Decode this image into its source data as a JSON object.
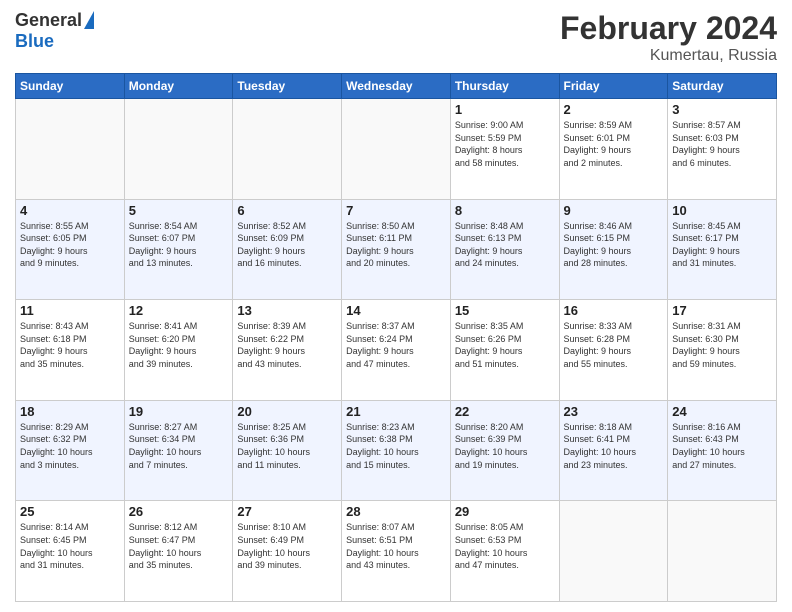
{
  "header": {
    "logo_general": "General",
    "logo_blue": "Blue",
    "title": "February 2024",
    "subtitle": "Kumertau, Russia"
  },
  "weekdays": [
    "Sunday",
    "Monday",
    "Tuesday",
    "Wednesday",
    "Thursday",
    "Friday",
    "Saturday"
  ],
  "weeks": [
    [
      {
        "day": "",
        "info": ""
      },
      {
        "day": "",
        "info": ""
      },
      {
        "day": "",
        "info": ""
      },
      {
        "day": "",
        "info": ""
      },
      {
        "day": "1",
        "info": "Sunrise: 9:00 AM\nSunset: 5:59 PM\nDaylight: 8 hours\nand 58 minutes."
      },
      {
        "day": "2",
        "info": "Sunrise: 8:59 AM\nSunset: 6:01 PM\nDaylight: 9 hours\nand 2 minutes."
      },
      {
        "day": "3",
        "info": "Sunrise: 8:57 AM\nSunset: 6:03 PM\nDaylight: 9 hours\nand 6 minutes."
      }
    ],
    [
      {
        "day": "4",
        "info": "Sunrise: 8:55 AM\nSunset: 6:05 PM\nDaylight: 9 hours\nand 9 minutes."
      },
      {
        "day": "5",
        "info": "Sunrise: 8:54 AM\nSunset: 6:07 PM\nDaylight: 9 hours\nand 13 minutes."
      },
      {
        "day": "6",
        "info": "Sunrise: 8:52 AM\nSunset: 6:09 PM\nDaylight: 9 hours\nand 16 minutes."
      },
      {
        "day": "7",
        "info": "Sunrise: 8:50 AM\nSunset: 6:11 PM\nDaylight: 9 hours\nand 20 minutes."
      },
      {
        "day": "8",
        "info": "Sunrise: 8:48 AM\nSunset: 6:13 PM\nDaylight: 9 hours\nand 24 minutes."
      },
      {
        "day": "9",
        "info": "Sunrise: 8:46 AM\nSunset: 6:15 PM\nDaylight: 9 hours\nand 28 minutes."
      },
      {
        "day": "10",
        "info": "Sunrise: 8:45 AM\nSunset: 6:17 PM\nDaylight: 9 hours\nand 31 minutes."
      }
    ],
    [
      {
        "day": "11",
        "info": "Sunrise: 8:43 AM\nSunset: 6:18 PM\nDaylight: 9 hours\nand 35 minutes."
      },
      {
        "day": "12",
        "info": "Sunrise: 8:41 AM\nSunset: 6:20 PM\nDaylight: 9 hours\nand 39 minutes."
      },
      {
        "day": "13",
        "info": "Sunrise: 8:39 AM\nSunset: 6:22 PM\nDaylight: 9 hours\nand 43 minutes."
      },
      {
        "day": "14",
        "info": "Sunrise: 8:37 AM\nSunset: 6:24 PM\nDaylight: 9 hours\nand 47 minutes."
      },
      {
        "day": "15",
        "info": "Sunrise: 8:35 AM\nSunset: 6:26 PM\nDaylight: 9 hours\nand 51 minutes."
      },
      {
        "day": "16",
        "info": "Sunrise: 8:33 AM\nSunset: 6:28 PM\nDaylight: 9 hours\nand 55 minutes."
      },
      {
        "day": "17",
        "info": "Sunrise: 8:31 AM\nSunset: 6:30 PM\nDaylight: 9 hours\nand 59 minutes."
      }
    ],
    [
      {
        "day": "18",
        "info": "Sunrise: 8:29 AM\nSunset: 6:32 PM\nDaylight: 10 hours\nand 3 minutes."
      },
      {
        "day": "19",
        "info": "Sunrise: 8:27 AM\nSunset: 6:34 PM\nDaylight: 10 hours\nand 7 minutes."
      },
      {
        "day": "20",
        "info": "Sunrise: 8:25 AM\nSunset: 6:36 PM\nDaylight: 10 hours\nand 11 minutes."
      },
      {
        "day": "21",
        "info": "Sunrise: 8:23 AM\nSunset: 6:38 PM\nDaylight: 10 hours\nand 15 minutes."
      },
      {
        "day": "22",
        "info": "Sunrise: 8:20 AM\nSunset: 6:39 PM\nDaylight: 10 hours\nand 19 minutes."
      },
      {
        "day": "23",
        "info": "Sunrise: 8:18 AM\nSunset: 6:41 PM\nDaylight: 10 hours\nand 23 minutes."
      },
      {
        "day": "24",
        "info": "Sunrise: 8:16 AM\nSunset: 6:43 PM\nDaylight: 10 hours\nand 27 minutes."
      }
    ],
    [
      {
        "day": "25",
        "info": "Sunrise: 8:14 AM\nSunset: 6:45 PM\nDaylight: 10 hours\nand 31 minutes."
      },
      {
        "day": "26",
        "info": "Sunrise: 8:12 AM\nSunset: 6:47 PM\nDaylight: 10 hours\nand 35 minutes."
      },
      {
        "day": "27",
        "info": "Sunrise: 8:10 AM\nSunset: 6:49 PM\nDaylight: 10 hours\nand 39 minutes."
      },
      {
        "day": "28",
        "info": "Sunrise: 8:07 AM\nSunset: 6:51 PM\nDaylight: 10 hours\nand 43 minutes."
      },
      {
        "day": "29",
        "info": "Sunrise: 8:05 AM\nSunset: 6:53 PM\nDaylight: 10 hours\nand 47 minutes."
      },
      {
        "day": "",
        "info": ""
      },
      {
        "day": "",
        "info": ""
      }
    ]
  ]
}
